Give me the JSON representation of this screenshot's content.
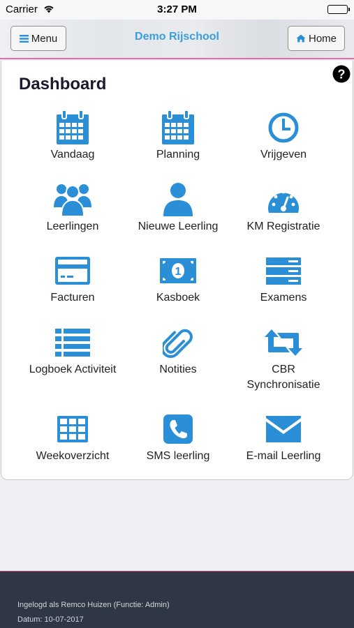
{
  "status_bar": {
    "carrier": "Carrier",
    "time": "3:27 PM"
  },
  "header": {
    "menu_label": "Menu",
    "title": "Demo Rijschool",
    "home_label": "Home"
  },
  "dashboard": {
    "title": "Dashboard",
    "tiles": [
      {
        "label": "Vandaag",
        "icon": "calendar-icon"
      },
      {
        "label": "Planning",
        "icon": "calendar-icon"
      },
      {
        "label": "Vrijgeven",
        "icon": "clock-icon"
      },
      {
        "label": "Leerlingen",
        "icon": "users-icon"
      },
      {
        "label": "Nieuwe Leerling",
        "icon": "user-icon"
      },
      {
        "label": "KM Registratie",
        "icon": "speedometer-icon"
      },
      {
        "label": "Facturen",
        "icon": "credit-card-icon"
      },
      {
        "label": "Kasboek",
        "icon": "money-icon"
      },
      {
        "label": "Examens",
        "icon": "server-icon"
      },
      {
        "label": "Logboek Activiteit",
        "icon": "list-icon"
      },
      {
        "label": "Notities",
        "icon": "paperclip-icon"
      },
      {
        "label": "CBR\nSynchronisatie",
        "icon": "retweet-icon"
      },
      {
        "label": "Weekoverzicht",
        "icon": "grid-icon"
      },
      {
        "label": "SMS leerling",
        "icon": "phone-icon"
      },
      {
        "label": "E-mail Leerling",
        "icon": "envelope-icon"
      }
    ]
  },
  "footer": {
    "logged_in": "Ingelogd als Remco Huizen (Functie: Admin)",
    "date": "Datum: 10-07-2017"
  },
  "colors": {
    "accent": "#2a8fd6",
    "title": "#3a9ed9",
    "footer_bg": "#2f3744",
    "pink_line": "#e86aa8"
  }
}
